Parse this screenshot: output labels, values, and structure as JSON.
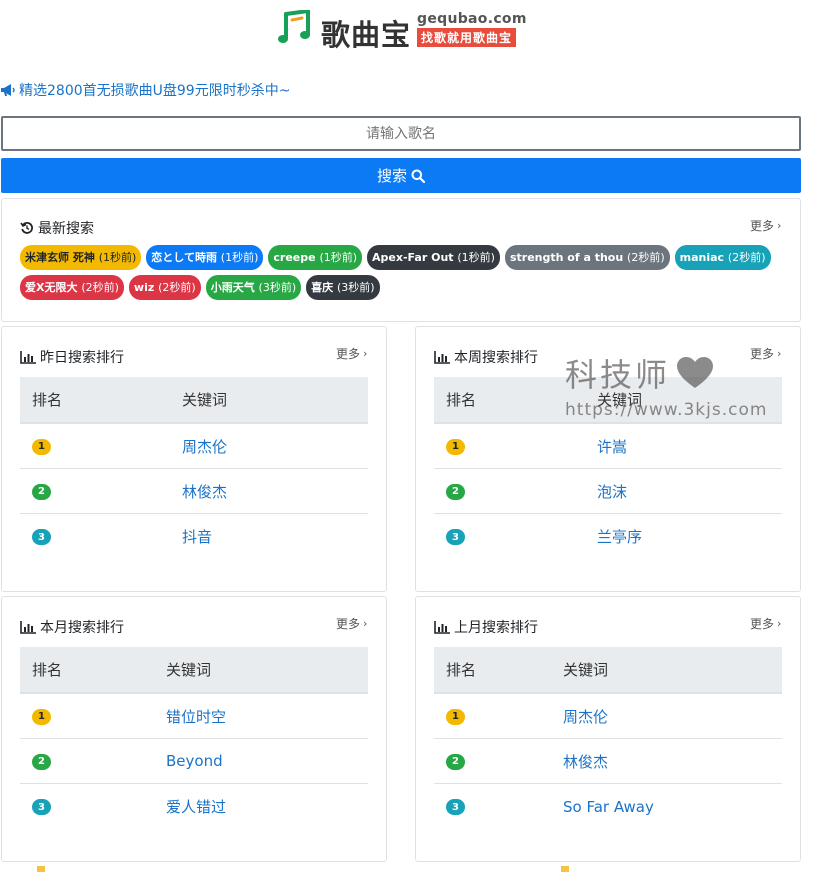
{
  "header": {
    "logo_text": "歌曲宝",
    "domain": "gequbao.com",
    "slogan": "找歌就用歌曲宝"
  },
  "promo": {
    "text": "精选2800首无损歌曲U盘99元限时秒杀中~"
  },
  "search": {
    "placeholder": "请输入歌名",
    "button_label": "搜索"
  },
  "recent": {
    "title": "最新搜索",
    "more": "更多",
    "tags_row1": [
      {
        "name": "米津玄师 死神",
        "ago": "(1秒前)",
        "color": "#f3b900",
        "text_color": "#212529"
      },
      {
        "name": "恋として時雨",
        "ago": "(1秒前)",
        "color": "#0d7af5",
        "text_color": "#ffffff"
      },
      {
        "name": "creepe",
        "ago": "(1秒前)",
        "color": "#28a745",
        "text_color": "#ffffff"
      },
      {
        "name": "Apex-Far Out",
        "ago": "(1秒前)",
        "color": "#343a40",
        "text_color": "#ffffff"
      },
      {
        "name": "strength of a thou",
        "ago": "(2秒前)",
        "color": "#6c757d",
        "text_color": "#ffffff"
      },
      {
        "name": "maniac",
        "ago": "(2秒前)",
        "color": "#17a2b8",
        "text_color": "#ffffff"
      }
    ],
    "tags_row2": [
      {
        "name": "爱X无限大",
        "ago": "(2秒前)",
        "color": "#dc3545",
        "text_color": "#ffffff"
      },
      {
        "name": "wiz",
        "ago": "(2秒前)",
        "color": "#dc3545",
        "text_color": "#ffffff"
      },
      {
        "name": "小雨天气",
        "ago": "(3秒前)",
        "color": "#28a745",
        "text_color": "#ffffff"
      },
      {
        "name": "喜庆",
        "ago": "(3秒前)",
        "color": "#343a40",
        "text_color": "#ffffff"
      }
    ]
  },
  "rankings": {
    "col_rank": "排名",
    "col_keyword": "关键词",
    "more": "更多",
    "badge_colors": [
      "#f3b900",
      "#28a745",
      "#17a2b8"
    ],
    "yesterday": {
      "title": "昨日搜索排行",
      "items": [
        {
          "rank": "1",
          "keyword": "周杰伦"
        },
        {
          "rank": "2",
          "keyword": "林俊杰"
        },
        {
          "rank": "3",
          "keyword": "抖音"
        }
      ]
    },
    "week": {
      "title": "本周搜索排行",
      "items": [
        {
          "rank": "1",
          "keyword": "许嵩"
        },
        {
          "rank": "2",
          "keyword": "泡沫"
        },
        {
          "rank": "3",
          "keyword": "兰亭序"
        }
      ]
    },
    "month": {
      "title": "本月搜索排行",
      "items": [
        {
          "rank": "1",
          "keyword": "错位时空"
        },
        {
          "rank": "2",
          "keyword": "Beyond"
        },
        {
          "rank": "3",
          "keyword": "爱人错过"
        }
      ]
    },
    "last_month": {
      "title": "上月搜索排行",
      "items": [
        {
          "rank": "1",
          "keyword": "周杰伦"
        },
        {
          "rank": "2",
          "keyword": "林俊杰"
        },
        {
          "rank": "3",
          "keyword": "So Far Away"
        }
      ]
    }
  },
  "watermark": {
    "text": "科技师",
    "url": "https://www.3kjs.com"
  }
}
